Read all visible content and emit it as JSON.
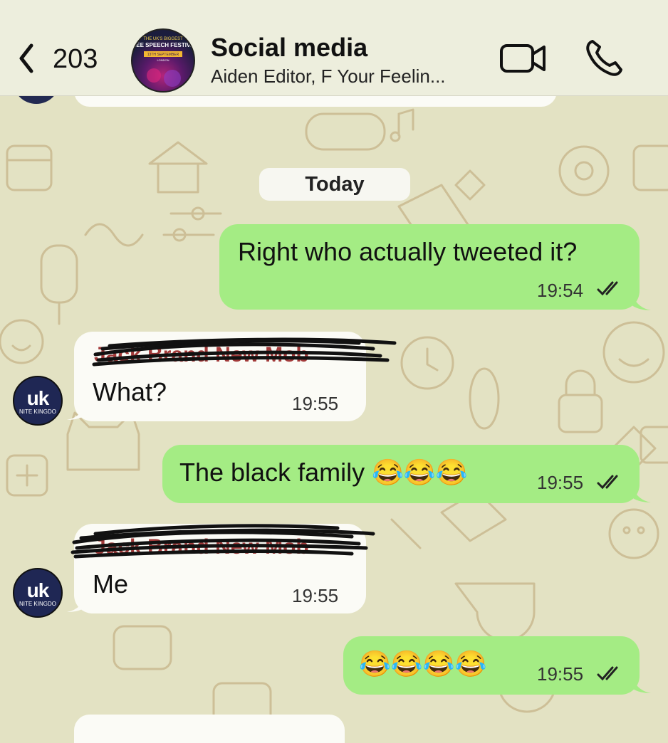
{
  "header": {
    "back_count": "203",
    "group_name": "Social media",
    "members": "Aiden Editor, F Your Feelin...",
    "avatar_text_1": "THE UK'S BIGGEST",
    "avatar_text_2": "FREE SPEECH FESTIVAL",
    "avatar_text_3": "13TH SEPTEMBER",
    "avatar_text_4": "LONDON"
  },
  "date_divider": "Today",
  "avatar_user": {
    "initials": "uk",
    "caption": "NITE KINGDO"
  },
  "messages": [
    {
      "direction": "outgoing",
      "text": "Right who actually tweeted it?",
      "time": "19:54",
      "read": true
    },
    {
      "direction": "incoming",
      "sender": "Jack Brand New Mob",
      "text": "What?",
      "time": "19:55"
    },
    {
      "direction": "outgoing",
      "text": "The black family",
      "emoji": "😂😂😂",
      "time": "19:55",
      "read": true
    },
    {
      "direction": "incoming",
      "sender": "Jack Brand New Mob",
      "text": "Me",
      "time": "19:55"
    },
    {
      "direction": "outgoing",
      "text": "",
      "emoji": "😂😂😂😂",
      "time": "19:55",
      "read": true
    }
  ],
  "colors": {
    "outgoing_bubble": "#a4ec84",
    "incoming_bubble": "#fbfbf6",
    "wallpaper": "#e3e2c3",
    "sender_name": "#a33a3a"
  }
}
